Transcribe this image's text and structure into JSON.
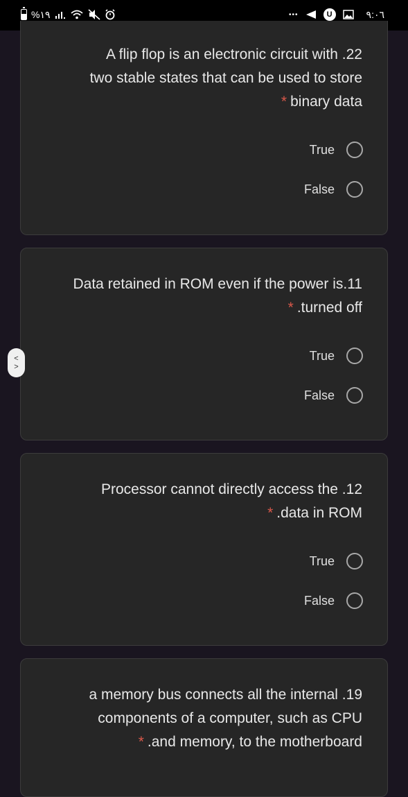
{
  "status_bar": {
    "left_text": "%١٩",
    "time": "٩:٠٦",
    "more": "•••",
    "u_badge": "U"
  },
  "questions": [
    {
      "lines": [
        "A flip flop is an electronic circuit with .22",
        "two stable states that can be used to store"
      ],
      "last_line": "binary data",
      "required_mark": "*",
      "options": [
        "True",
        "False"
      ]
    },
    {
      "lines": [
        "Data retained in ROM even if the power is.11"
      ],
      "last_line": ".turned off",
      "required_mark": "*",
      "options": [
        "True",
        "False"
      ]
    },
    {
      "lines": [
        "Processor cannot directly access the .12"
      ],
      "last_line": ".data in ROM",
      "required_mark": "*",
      "options": [
        "True",
        "False"
      ]
    },
    {
      "lines": [
        "a memory bus connects all the internal .19",
        "components of a computer, such as CPU"
      ],
      "last_line": ".and memory, to the motherboard",
      "required_mark": "*",
      "options": []
    }
  ],
  "side_handle": {
    "up": "<",
    "down": ">"
  },
  "colors": {
    "background": "#1a1520",
    "card": "#262626",
    "required": "#d9584a",
    "radio_border": "#a8a8a8"
  }
}
